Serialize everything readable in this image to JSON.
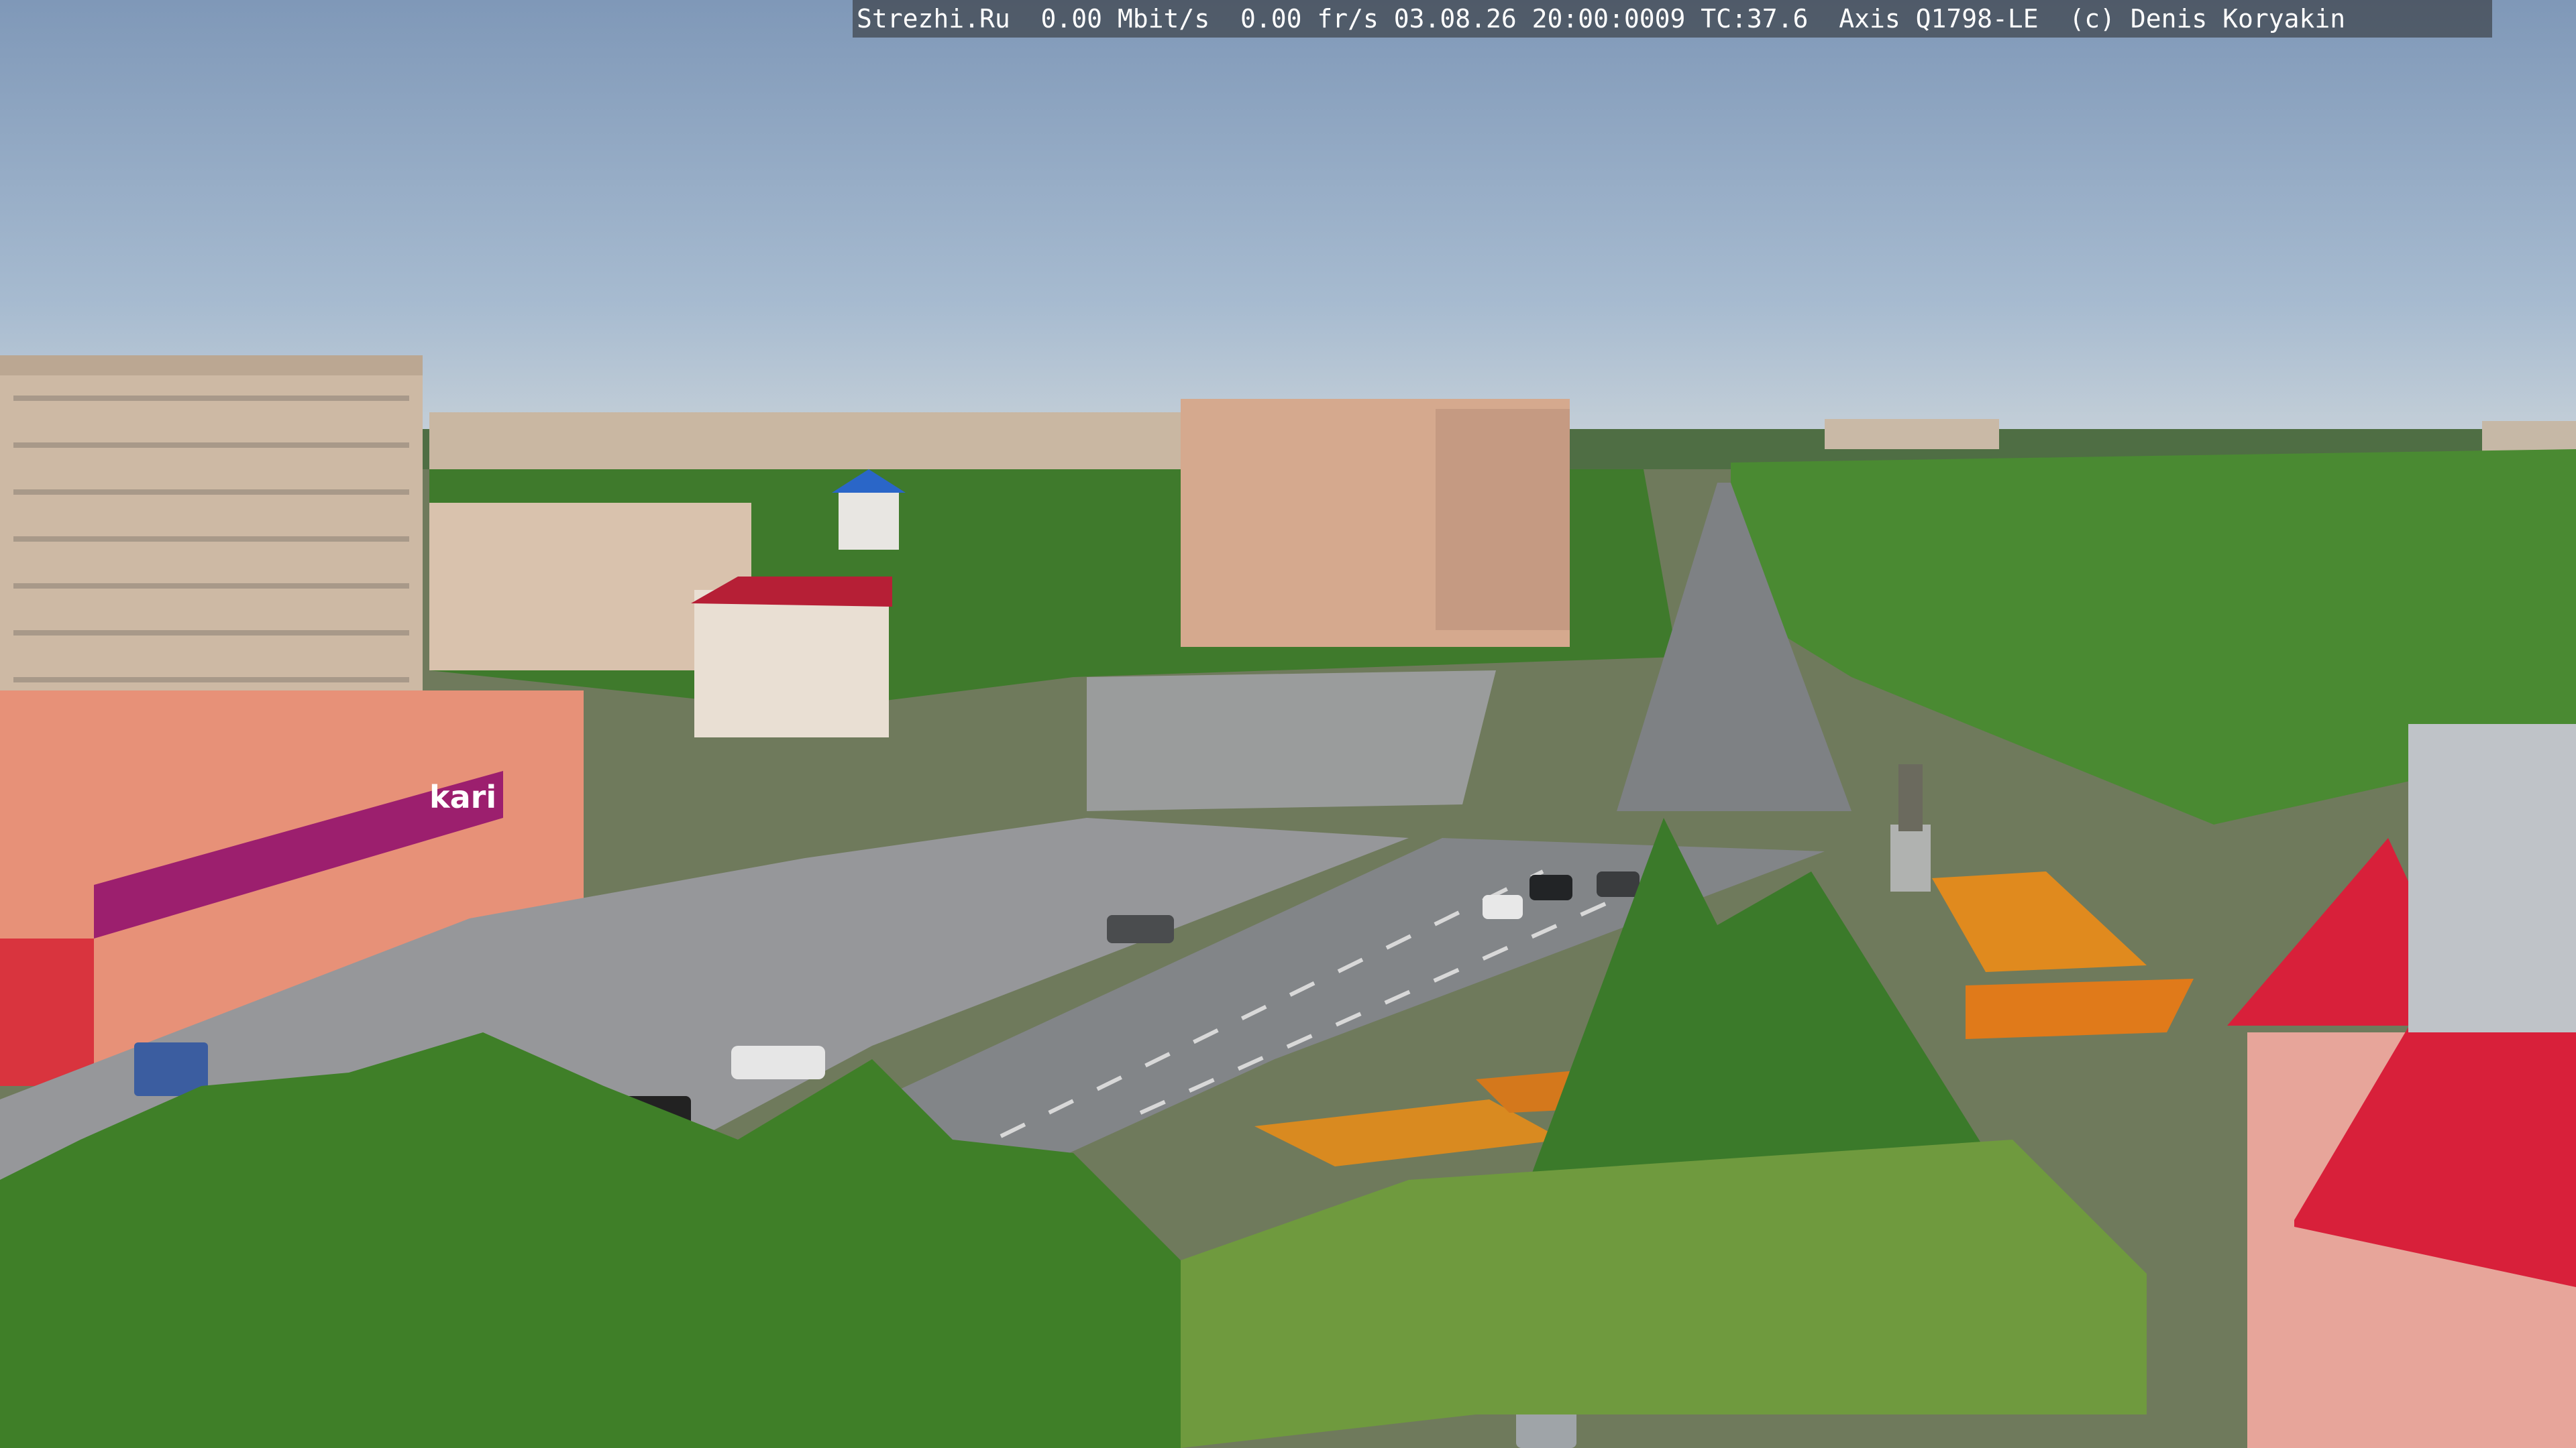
{
  "overlay": {
    "text": "Strezhi.Ru  0.00 Mbit/s  0.00 fr/s 03.08.26 20:00:0009 TC:37.6  Axis Q1798-LE  (c) Denis Koryakin"
  },
  "signs": {
    "store": "kari"
  },
  "colors": {
    "sky": "#8ea7c4",
    "road": "#8a8c8e",
    "tree": "#4e8a2e",
    "roof_red": "#d8203a",
    "store_banner": "#9c1f6e"
  }
}
